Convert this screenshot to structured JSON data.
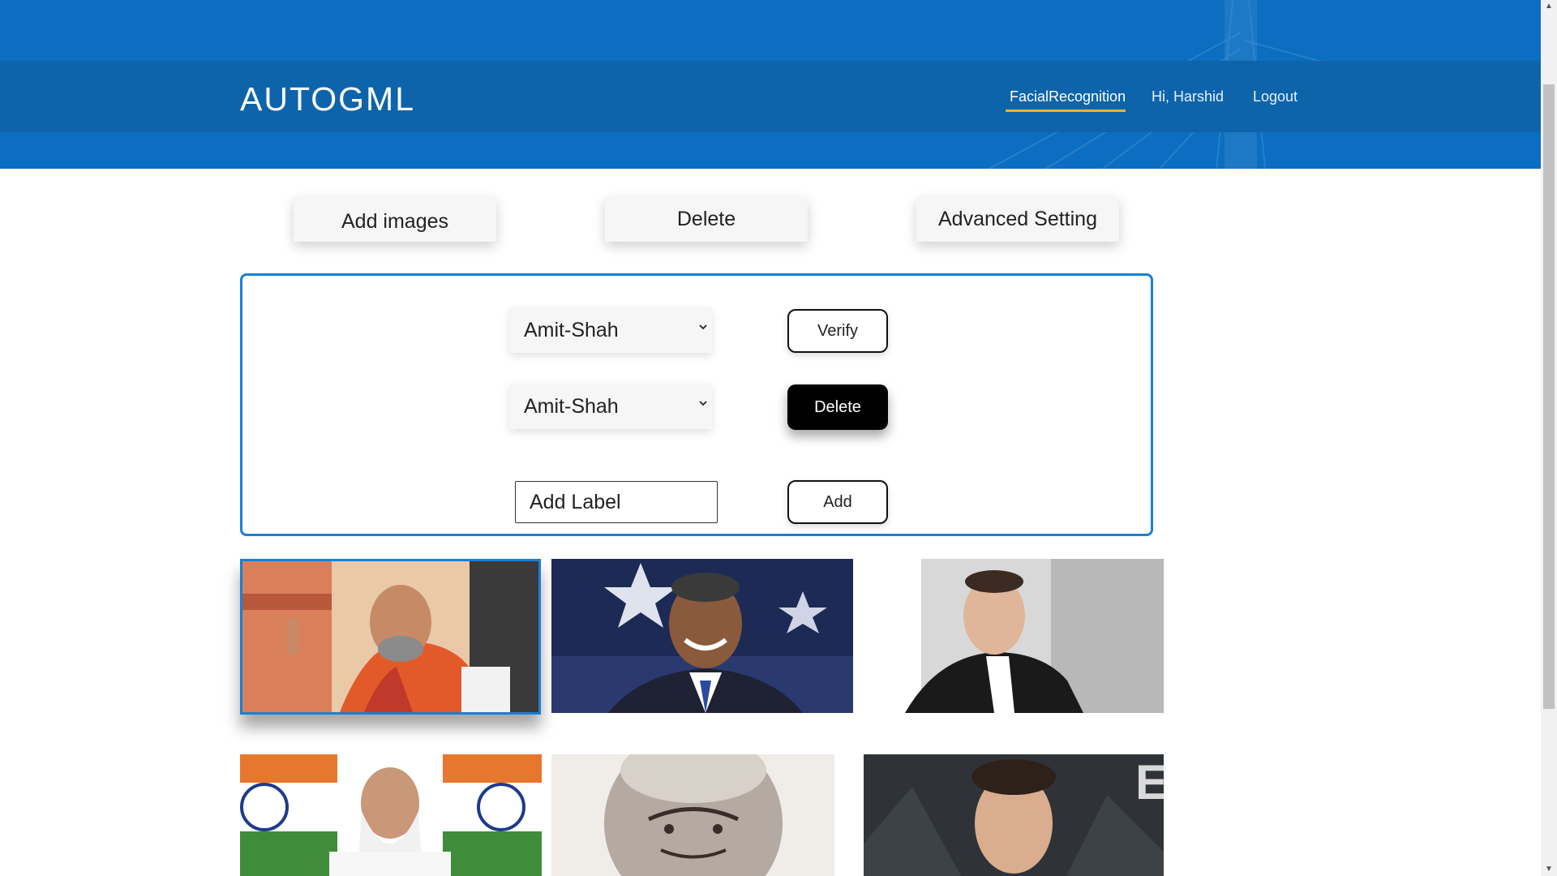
{
  "header": {
    "brand": "AUTOGML",
    "nav": [
      {
        "label": "FacialRecognition",
        "active": true
      },
      {
        "label": "Hi, Harshid",
        "active": false
      },
      {
        "label": "Logout",
        "active": false
      }
    ],
    "colors": {
      "hero": "#0b6ec0",
      "navbar": "#0d64aa",
      "underline": "#f0b429"
    }
  },
  "actions": {
    "add_images": "Add images",
    "delete": "Delete",
    "advanced": "Advanced Setting"
  },
  "panel": {
    "verify_select": {
      "value": "Amit-Shah"
    },
    "verify_button": "Verify",
    "delete_select": {
      "value": "Amit-Shah"
    },
    "delete_button": "Delete",
    "label_input": {
      "value": "",
      "placeholder": "Add Label"
    },
    "add_button": "Add",
    "border_color": "#1a7fd6"
  },
  "gallery": [
    {
      "subject": "portrait-orange-scarf",
      "selected": true
    },
    {
      "subject": "portrait-flag-background",
      "selected": false
    },
    {
      "subject": "portrait-dark-suit",
      "selected": false
    },
    {
      "subject": "portrait-flag-white-beard",
      "selected": false
    },
    {
      "subject": "portrait-vintage-bald",
      "selected": false
    },
    {
      "subject": "portrait-dark-backdrop",
      "selected": false
    }
  ]
}
